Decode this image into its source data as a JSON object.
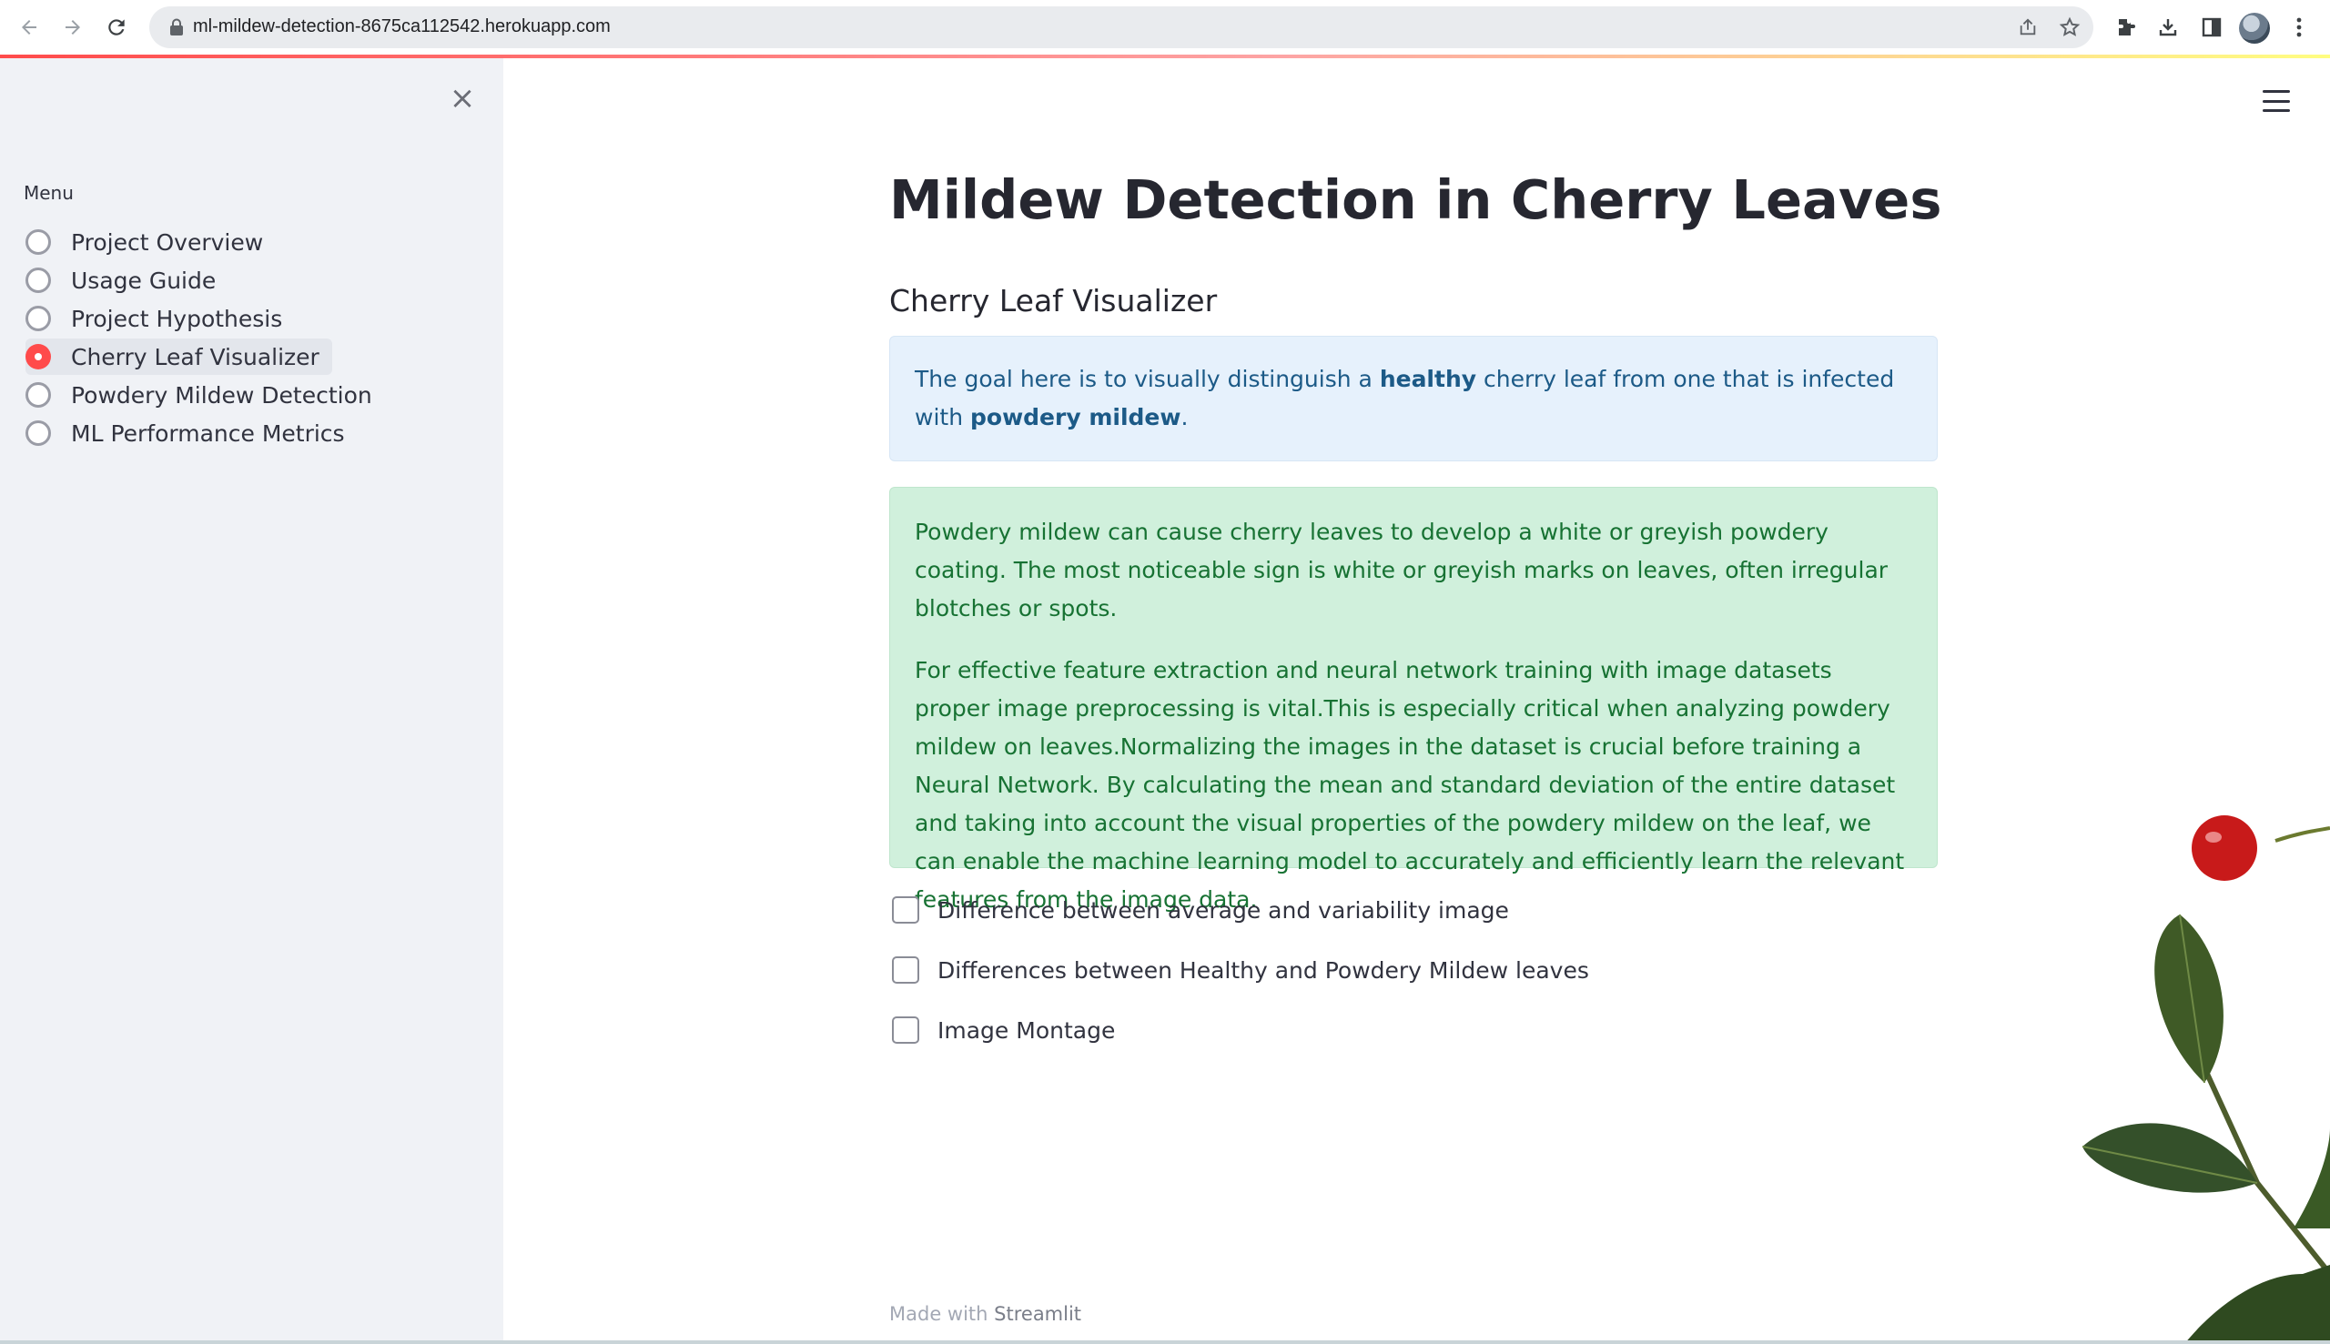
{
  "browser": {
    "url": "ml-mildew-detection-8675ca112542.herokuapp.com",
    "icons": [
      "back-icon",
      "forward-icon",
      "reload-icon",
      "lock-icon",
      "share-icon",
      "star-icon",
      "extensions-icon",
      "download-icon",
      "side-panel-icon",
      "avatar",
      "more-vert-icon"
    ]
  },
  "sidebar": {
    "close_glyph": "×",
    "menu_label": "Menu",
    "items": [
      {
        "label": "Project Overview",
        "selected": false
      },
      {
        "label": "Usage Guide",
        "selected": false
      },
      {
        "label": "Project Hypothesis",
        "selected": false
      },
      {
        "label": "Cherry Leaf Visualizer",
        "selected": true
      },
      {
        "label": "Powdery Mildew Detection",
        "selected": false
      },
      {
        "label": "ML Performance Metrics",
        "selected": false
      }
    ]
  },
  "main": {
    "title": "Mildew Detection in Cherry Leaves",
    "subheader": "Cherry Leaf Visualizer",
    "info": {
      "part1": "The goal here is to visually distinguish a ",
      "bold1": "healthy",
      "part2": " cherry leaf from one that is infected with ",
      "bold2": "powdery mildew",
      "part3": "."
    },
    "success": {
      "paragraph1": "Powdery mildew can cause cherry leaves to develop a white or greyish powdery coating. The most noticeable sign is white or greyish marks on leaves, often irregular blotches or spots.",
      "paragraph2": "For effective feature extraction and neural network training with image datasets proper image preprocessing is vital.This is especially critical when analyzing powdery mildew on leaves.Normalizing the images in the dataset is crucial before training a Neural Network. By calculating the mean and standard deviation of the entire dataset and taking into account the visual properties of the powdery mildew on the leaf, we can enable the machine learning model to accurately and efficiently learn the relevant features from the image data."
    },
    "checkboxes": [
      {
        "label": "Difference between average and variability image",
        "checked": false
      },
      {
        "label": "Differences between Healthy and Powdery Mildew leaves",
        "checked": false
      },
      {
        "label": "Image Montage",
        "checked": false
      }
    ]
  },
  "footer": {
    "prefix": "Made with ",
    "brand": "Streamlit"
  },
  "colors": {
    "accent": "#ff4b4b",
    "sidebar_bg": "#f0f2f6",
    "info_bg": "#e6f1fc",
    "info_text": "#1c5a87",
    "success_bg": "#d0f0dc",
    "success_text": "#177233"
  }
}
